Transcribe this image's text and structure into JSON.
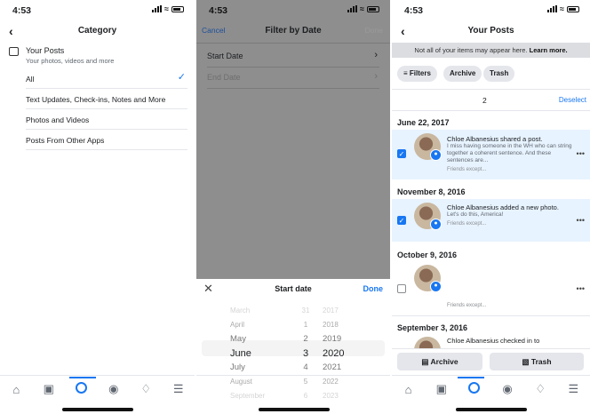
{
  "status_time": "4:53",
  "panel1": {
    "title": "Category",
    "your_posts_title": "Your Posts",
    "your_posts_subtitle": "Your photos, videos and more",
    "categories": [
      "All",
      "Text Updates, Check-ins, Notes and More",
      "Photos and Videos",
      "Posts From Other Apps"
    ],
    "selected": "All"
  },
  "panel2": {
    "cancel": "Cancel",
    "title": "Filter by Date",
    "done_top": "Done",
    "rows": [
      "Start Date",
      "End Date"
    ],
    "sheet_title": "Start date",
    "sheet_done": "Done",
    "months": [
      "March",
      "April",
      "May",
      "June",
      "July",
      "August",
      "September"
    ],
    "days": [
      "31",
      "1",
      "2",
      "3",
      "4",
      "5",
      "6"
    ],
    "years": [
      "2017",
      "2018",
      "2019",
      "2020",
      "2021",
      "2022",
      "2023"
    ]
  },
  "panel3": {
    "title": "Your Posts",
    "notice_text": "Not all of your items may appear here.",
    "notice_link": "Learn more.",
    "chips": [
      "Filters",
      "Archive",
      "Trash"
    ],
    "selected_count": "2",
    "deselect": "Deselect",
    "groups": [
      {
        "date": "June 22, 2017",
        "title": "Chloe Albanesius shared a post.",
        "sub": "I miss having someone in the WH who can string together a coherent sentence. And these sentences are...",
        "meta": "Friends except..."
      },
      {
        "date": "November 8, 2016",
        "title": "Chloe Albanesius added a new photo.",
        "sub": "Let's do this, America!",
        "meta": "Friends except..."
      },
      {
        "date": "October 9, 2016",
        "title": "",
        "sub": "",
        "meta": "Friends except..."
      },
      {
        "date": "September 3, 2016",
        "title": "Chloe Albanesius checked in to",
        "sub": "",
        "meta": ""
      }
    ],
    "archive_btn": "Archive",
    "trash_btn": "Trash"
  },
  "colors": {
    "accent": "#1877f2",
    "selected_row": "#e7f3ff",
    "dim_overlay": "#8e8e8e"
  }
}
